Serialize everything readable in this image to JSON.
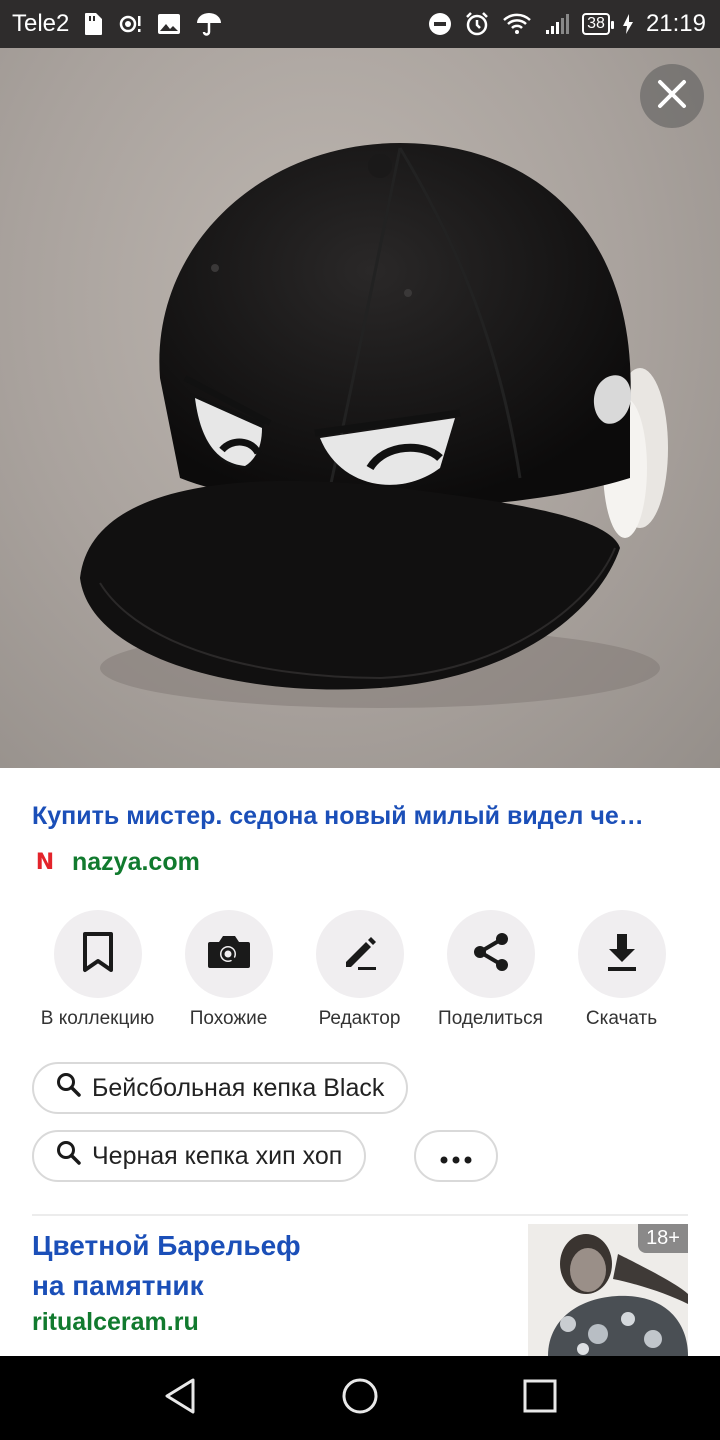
{
  "status_bar": {
    "carrier": "Tele2",
    "battery": "38",
    "time": "21:19",
    "left_icons": [
      "sim-card-icon",
      "hotspot-icon",
      "gallery-icon",
      "umbrella-icon"
    ],
    "right_icons": [
      "do-not-disturb-icon",
      "alarm-icon",
      "wifi-icon",
      "signal-icon",
      "battery-icon",
      "charging-icon"
    ]
  },
  "viewer": {
    "image_subject": "black-snapback-cap-with-eyes-photo",
    "close_icon": "close-icon"
  },
  "result": {
    "title": "Купить мистер. седона новый милый видел че…",
    "domain": "nazya.com",
    "source_logo": "N"
  },
  "actions": [
    {
      "label": "В коллекцию",
      "icon": "bookmark-icon"
    },
    {
      "label": "Похожие",
      "icon": "camera-search-icon"
    },
    {
      "label": "Редактор",
      "icon": "pencil-icon"
    },
    {
      "label": "Поделиться",
      "icon": "share-icon"
    },
    {
      "label": "Скачать",
      "icon": "download-icon"
    }
  ],
  "suggestions": [
    {
      "label": "Бейсбольная кепка Black",
      "icon": "search-icon"
    },
    {
      "label": "Черная кепка хип хоп",
      "icon": "search-icon"
    }
  ],
  "more_chip": {
    "icon": "more-icon"
  },
  "ad": {
    "title_line1": "Цветной Барельеф",
    "title_line2": "на памятник",
    "domain": "ritualceram.ru",
    "age_badge": "18+"
  },
  "nav_bar": {
    "icons": [
      "back-icon",
      "home-icon",
      "recents-icon"
    ]
  },
  "colors": {
    "link_blue": "#1b4fb8",
    "domain_green": "#117a2e",
    "status_bar": "#2e2c2c",
    "action_circle": "#f0eef0"
  }
}
